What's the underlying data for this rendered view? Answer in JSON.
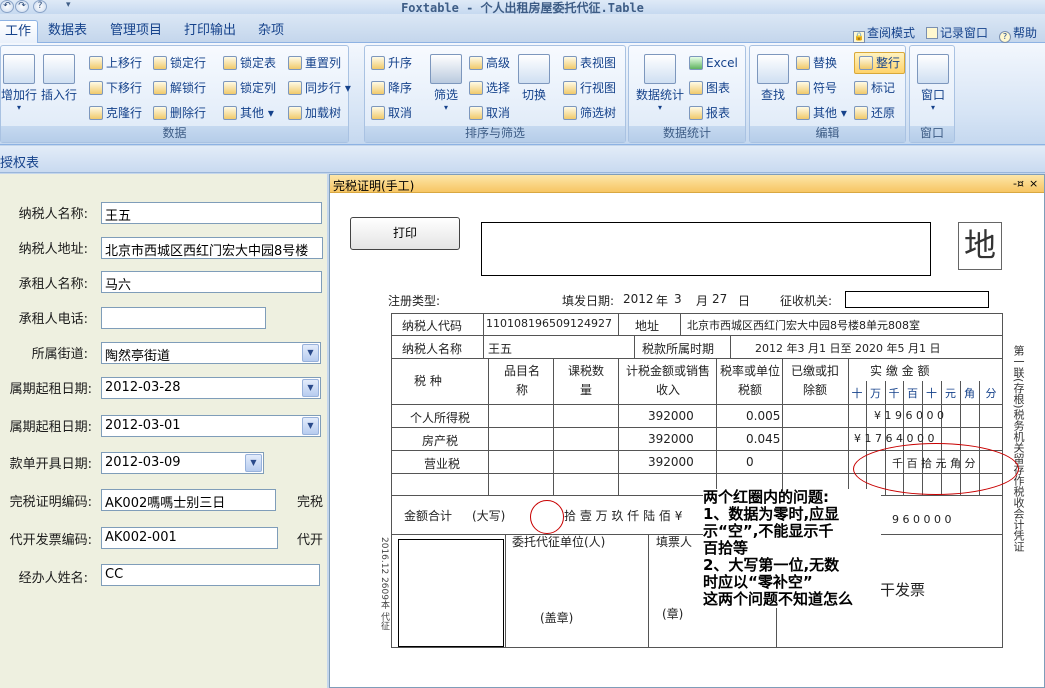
{
  "window": {
    "title": "Foxtable - 个人出租房屋委托代征.Table",
    "qat_icons": [
      "undo-icon",
      "redo-icon",
      "help-icon"
    ]
  },
  "menu": {
    "tabs": [
      "工作",
      "数据表",
      "管理项目",
      "打印输出",
      "杂项"
    ],
    "active_tab": "工作",
    "quick_links": [
      "查阅模式",
      "记录窗口",
      "帮助"
    ]
  },
  "ribbon": {
    "data_group": {
      "caption": "数据",
      "big_buttons": [
        "增加行",
        "插入行"
      ],
      "col1": [
        "上移行",
        "下移行",
        "克隆行"
      ],
      "col2": [
        "锁定行",
        "解锁行",
        "删除行"
      ],
      "col3": [
        "锁定表",
        "锁定列",
        "其他"
      ],
      "col4": [
        "重置列",
        "同步行",
        "加载树"
      ]
    },
    "sort_group": {
      "caption": "排序与筛选",
      "small1": [
        "升序",
        "降序",
        "取消"
      ],
      "big_filter": "筛选",
      "small2": [
        "高级",
        "选择",
        "取消"
      ],
      "big_switch": "切换",
      "small3": [
        "表视图",
        "行视图",
        "筛选树"
      ]
    },
    "stats_group": {
      "caption": "数据统计",
      "big_stats": "数据统计",
      "small": [
        "Excel",
        "图表",
        "报表"
      ]
    },
    "edit_group": {
      "caption": "编辑",
      "big_find": "查找",
      "col1": [
        "替换",
        "符号",
        "其他"
      ],
      "col2": [
        "整行",
        "标记",
        "还原"
      ]
    },
    "window_group": {
      "caption": "窗口",
      "big_window": "窗口"
    }
  },
  "doc_tab": "授权表",
  "form": {
    "fields": [
      {
        "label": "纳税人名称:",
        "value": "王五"
      },
      {
        "label": "纳税人地址:",
        "value": "北京市西城区西红门宏大中园8号楼"
      },
      {
        "label": "承租人名称:",
        "value": "马六"
      },
      {
        "label": "承租人电话:",
        "value": ""
      },
      {
        "label": "所属街道:",
        "value": "陶然亭街道"
      },
      {
        "label": "属期起租日期:",
        "value": "2012-03-28"
      },
      {
        "label": "属期起租日期:",
        "value": "2012-03-01"
      },
      {
        "label": "款单开具日期:",
        "value": "2012-03-09"
      },
      {
        "label": "完税证明编码:",
        "value": "AK002嗎嗎士别三日"
      },
      {
        "label": "代开发票编码:",
        "value": "AK002-001"
      },
      {
        "label": "经办人姓名:",
        "value": "CC"
      }
    ],
    "side_labels": [
      "完税",
      "代开"
    ]
  },
  "cert_window": {
    "title": "完税证明(手工)",
    "controls": "-¤ ×",
    "print_button": "打印",
    "di_char": "地",
    "header": {
      "reg_type_label": "注册类型:",
      "fill_date_label": "填发日期:",
      "fill_year": "2012",
      "year_char": "年",
      "fill_month": "3",
      "month_char": "月",
      "fill_day": "27",
      "day_char": "日",
      "org_label": "征收机关:"
    },
    "table": {
      "taxpayer_code_label": "纳税人代码",
      "taxpayer_code": "110108196509124927",
      "address_label": "地址",
      "address": "北京市西城区西红门宏大中园8号楼8单元808室",
      "taxpayer_name_label": "纳税人名称",
      "taxpayer_name": "王五",
      "period_label": "税款所属时期",
      "period_text": "2012  年3  月1  日至  2020  年5  月1  日",
      "col_tax_type": "税  种",
      "col_item": "品目名称",
      "col_qty": "课税数量",
      "col_amount": "计税金额或销售收入",
      "col_rate": "税率或单位税额",
      "col_paid": "已缴或扣除额",
      "col_actual": "实  缴  金  额",
      "digit_headers": [
        "十",
        "万",
        "千",
        "百",
        "十",
        "元",
        "角",
        "分"
      ],
      "rows": [
        {
          "tax": "个人所得税",
          "amount": "392000",
          "rate": "0.005",
          "paid": "¥  1  9  6  0  0  0"
        },
        {
          "tax": "房产税",
          "amount": "392000",
          "rate": "0.045",
          "paid": "¥  1  7  6  4  0  0  0"
        },
        {
          "tax": "营业税",
          "amount": "392000",
          "rate": "0",
          "paid": "千  百  拾  元  角  分"
        }
      ],
      "total_label": "金额合计",
      "total_upper": "(大写)",
      "total_chars": "拾  壹  万  玖  仟  陆  佰  ¥",
      "total_digits": "9  6  0  0  0  0",
      "agent_label": "委托代征单位(人)",
      "agent_seal": "(盖章)",
      "filler_label": "填票人",
      "filler_seal": "(章)",
      "invoice_text": "干发票",
      "side_vertical": "第一联(存根)税务机关留存作税收会计凭证",
      "left_vertical": "2016.12 2609本 代征"
    },
    "annotation": [
      "两个红圈内的问题:",
      "1、数据为零时,应显",
      "示“空”,不能显示千",
      "百拾等",
      "2、大写第一位,无数",
      "时应以“零补空”",
      "这两个问题不知道怎么"
    ]
  }
}
